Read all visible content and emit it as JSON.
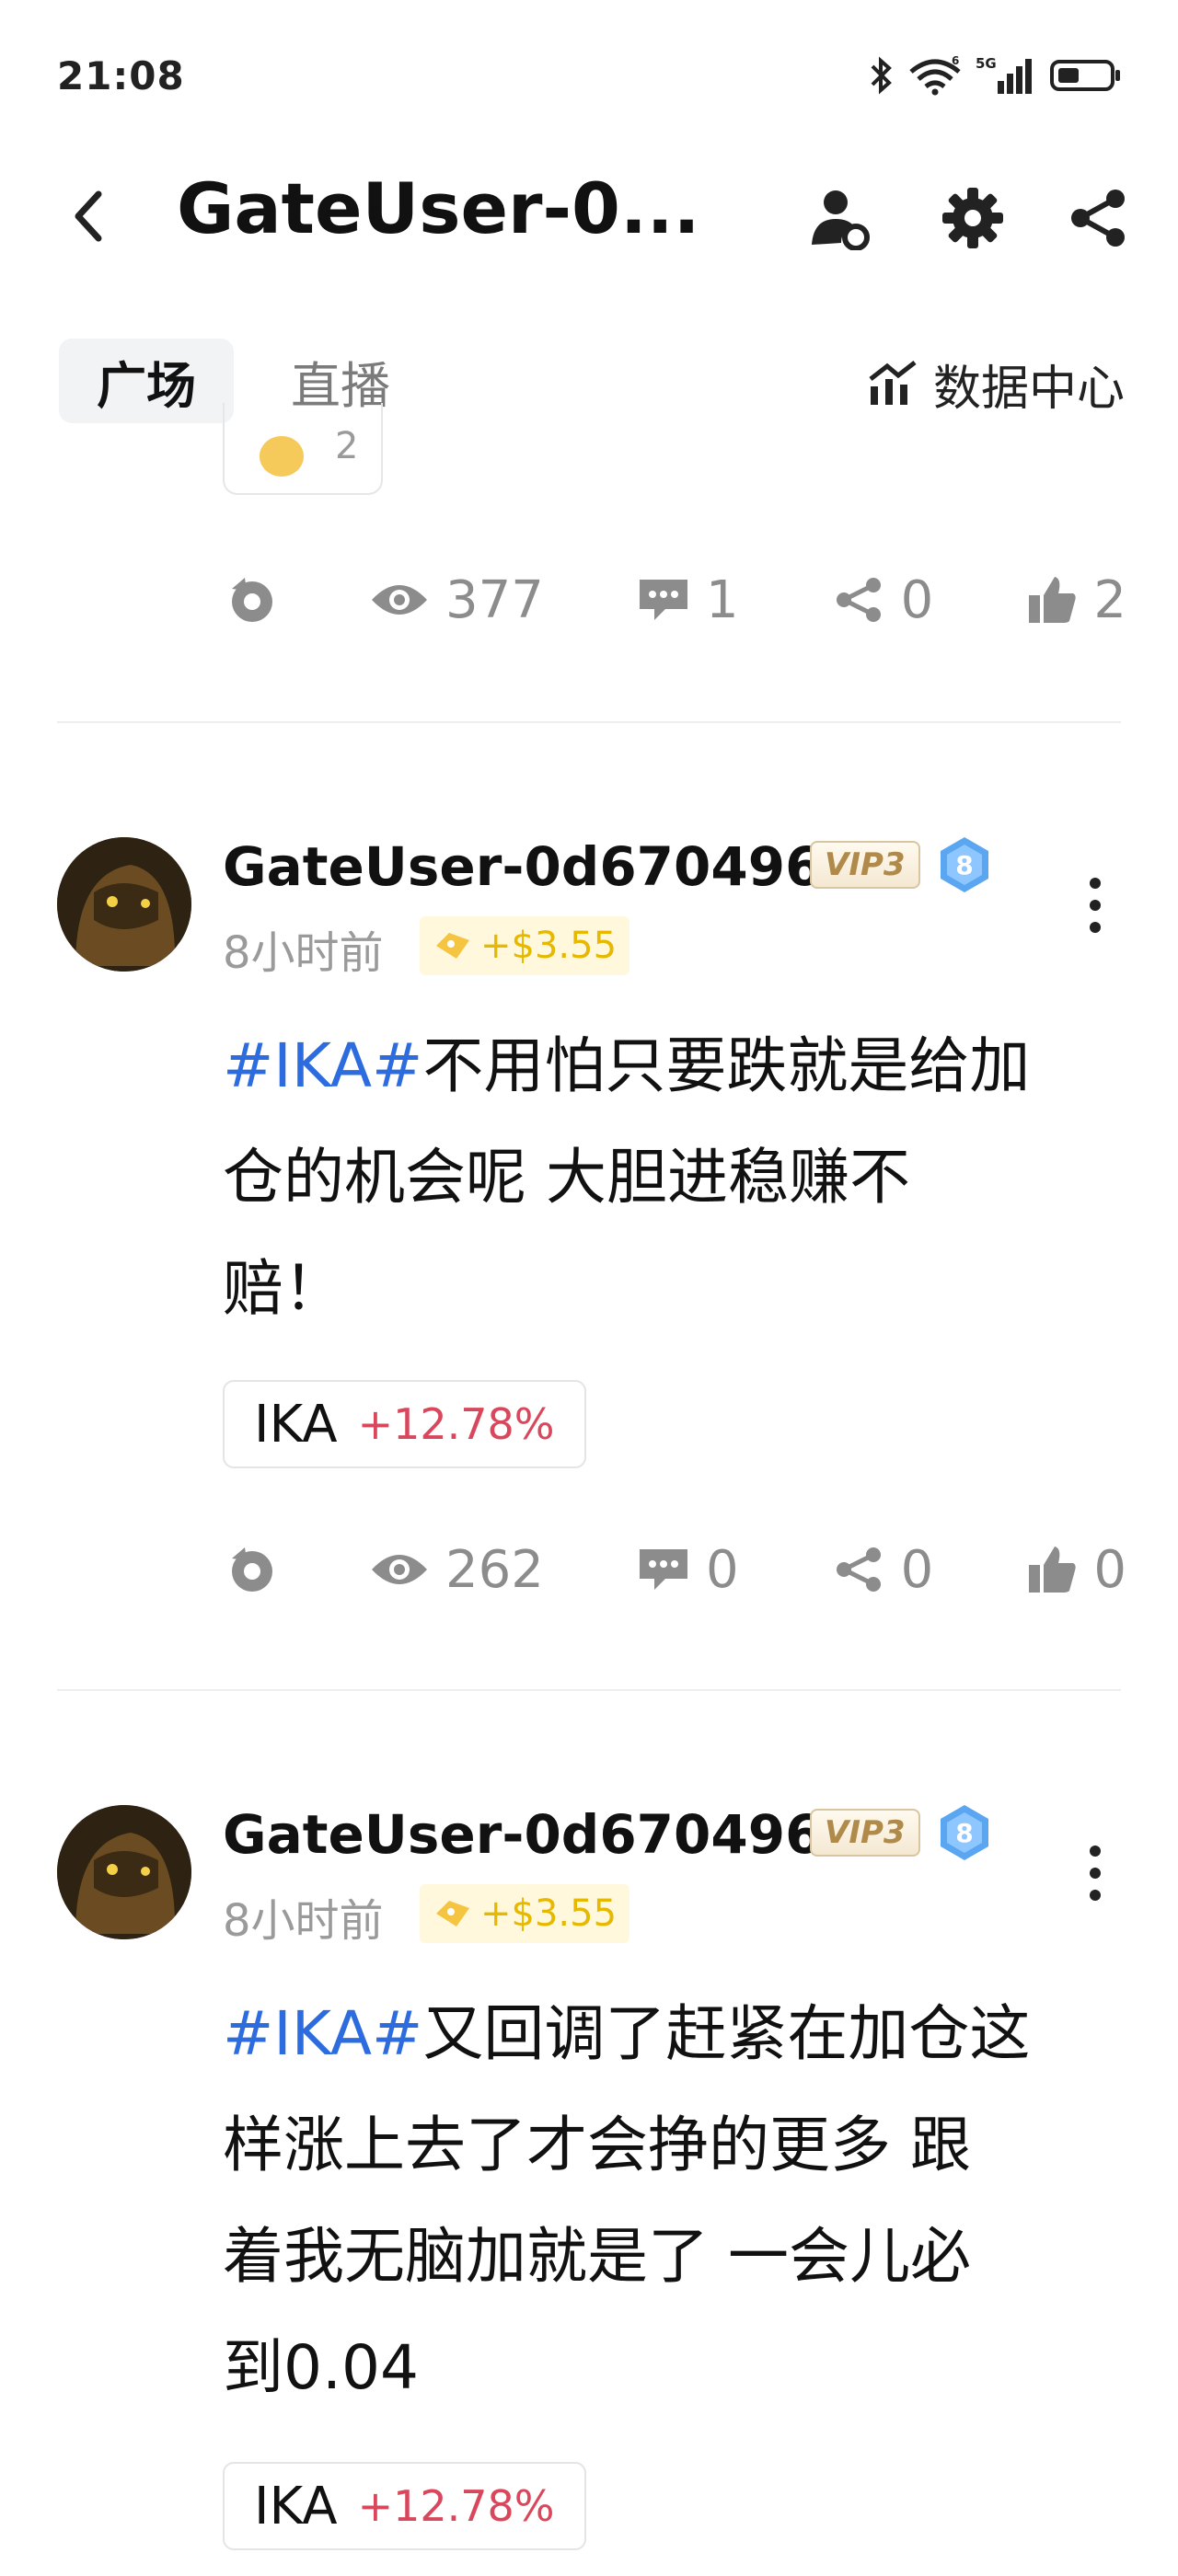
{
  "status_bar": {
    "time": "21:08",
    "network": "5G",
    "wifi_badge": "6"
  },
  "header": {
    "title": "GateUser-0..."
  },
  "tabs": [
    {
      "label": "广场",
      "active": true
    },
    {
      "label": "直播",
      "active": false
    }
  ],
  "data_center": {
    "label": "数据中心"
  },
  "prev_post": {
    "reaction_count": "2",
    "stats": {
      "views": "377",
      "comments": "1",
      "shares": "0",
      "likes": "2"
    }
  },
  "posts": [
    {
      "username": "GateUser-0d670496",
      "vip": "VIP3",
      "level": "8",
      "time": "8小时前",
      "tip": "+$3.55",
      "hashtag": "#IKA#",
      "lines": [
        "不用怕只要跌就是给加",
        "仓的机会呢 大胆进稳赚不",
        "赔！"
      ],
      "token": {
        "name": "IKA",
        "change": "+12.78%"
      },
      "stats": {
        "views": "262",
        "comments": "0",
        "shares": "0",
        "likes": "0"
      }
    },
    {
      "username": "GateUser-0d670496",
      "vip": "VIP3",
      "level": "8",
      "time": "8小时前",
      "tip": "+$3.55",
      "hashtag": "#IKA#",
      "lines": [
        "又回调了赶紧在加仓这",
        "样涨上去了才会挣的更多 跟",
        "着我无脑加就是了 一会儿必",
        "到0.04"
      ],
      "token": {
        "name": "IKA",
        "change": "+12.78%"
      }
    }
  ],
  "colors": {
    "hashtag": "#2d6cdf",
    "price_up": "#d9475c",
    "tip_text": "#e6b800",
    "muted": "#8c8c8c"
  }
}
